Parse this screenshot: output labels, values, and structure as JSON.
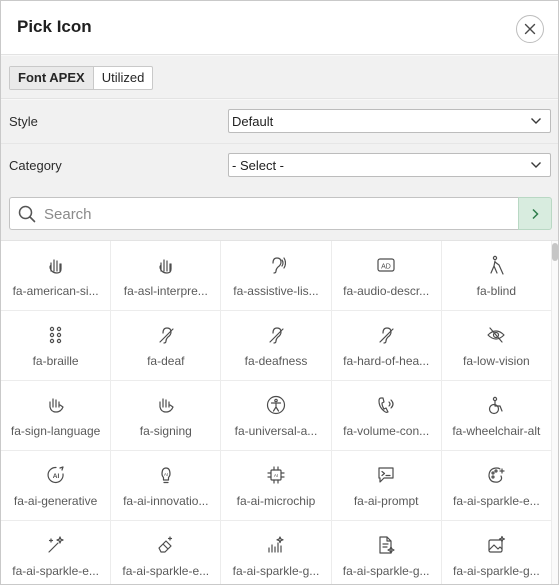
{
  "dialog": {
    "title": "Pick Icon",
    "close_icon": "close-icon"
  },
  "tabs": [
    {
      "label": "Font APEX",
      "active": true
    },
    {
      "label": "Utilized",
      "active": false
    }
  ],
  "form": {
    "style": {
      "label": "Style",
      "value": "Default"
    },
    "category": {
      "label": "Category",
      "value": "- Select -"
    }
  },
  "search": {
    "placeholder": "Search",
    "value": "",
    "go_icon": "chevron-right-icon"
  },
  "colors": {
    "accent_green": "#d8ecdf",
    "panel_bg": "#f1f1f1"
  },
  "icons": [
    {
      "label": "fa-american-si...",
      "icon": "hand-rock-icon"
    },
    {
      "label": "fa-asl-interpre...",
      "icon": "hand-rock-icon"
    },
    {
      "label": "fa-assistive-lis...",
      "icon": "ear-waves-icon"
    },
    {
      "label": "fa-audio-descr...",
      "icon": "audio-description-icon"
    },
    {
      "label": "fa-blind",
      "icon": "blind-person-icon"
    },
    {
      "label": "fa-braille",
      "icon": "braille-icon"
    },
    {
      "label": "fa-deaf",
      "icon": "deaf-ear-icon"
    },
    {
      "label": "fa-deafness",
      "icon": "deaf-ear-icon"
    },
    {
      "label": "fa-hard-of-hea...",
      "icon": "deaf-ear-icon"
    },
    {
      "label": "fa-low-vision",
      "icon": "eye-slash-icon"
    },
    {
      "label": "fa-sign-language",
      "icon": "sign-hand-icon"
    },
    {
      "label": "fa-signing",
      "icon": "sign-hand-icon"
    },
    {
      "label": "fa-universal-a...",
      "icon": "universal-access-icon"
    },
    {
      "label": "fa-volume-con...",
      "icon": "volume-control-phone-icon"
    },
    {
      "label": "fa-wheelchair-alt",
      "icon": "wheelchair-icon"
    },
    {
      "label": "fa-ai-generative",
      "icon": "ai-circle-icon"
    },
    {
      "label": "fa-ai-innovatio...",
      "icon": "lightbulb-icon"
    },
    {
      "label": "fa-ai-microchip",
      "icon": "microchip-icon"
    },
    {
      "label": "fa-ai-prompt",
      "icon": "prompt-chat-icon"
    },
    {
      "label": "fa-ai-sparkle-e...",
      "icon": "palette-sparkle-icon"
    },
    {
      "label": "fa-ai-sparkle-e...",
      "icon": "wand-sparkle-icon"
    },
    {
      "label": "fa-ai-sparkle-e...",
      "icon": "eraser-sparkle-icon"
    },
    {
      "label": "fa-ai-sparkle-g...",
      "icon": "chart-sparkle-icon"
    },
    {
      "label": "fa-ai-sparkle-g...",
      "icon": "document-sparkle-icon"
    },
    {
      "label": "fa-ai-sparkle-g...",
      "icon": "image-sparkle-icon"
    }
  ]
}
